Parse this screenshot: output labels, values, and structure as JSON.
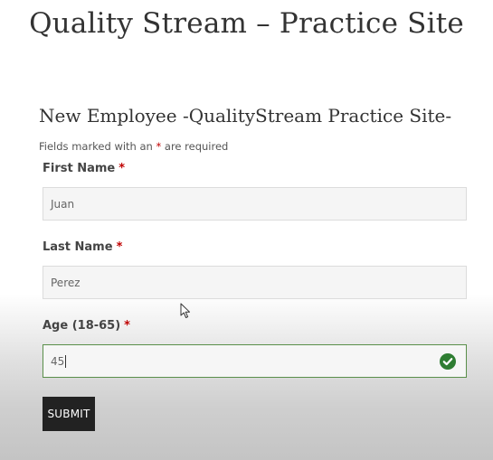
{
  "site": {
    "title": "Quality Stream – Practice Site"
  },
  "form": {
    "title": "New Employee -QualityStream Practice Site-",
    "required_note_prefix": "Fields marked with an",
    "required_note_star": "*",
    "required_note_suffix": "are required",
    "fields": [
      {
        "label": "First Name",
        "star": "*",
        "value": "Juan"
      },
      {
        "label": "Last Name",
        "star": "*",
        "value": "Perez"
      },
      {
        "label": "Age (18-65)",
        "star": "*",
        "value": "45"
      }
    ],
    "submit_label": "SUBMIT"
  },
  "colors": {
    "required_star": "#c00000",
    "valid_border": "#5a8f4a",
    "valid_check": "#2e7d32",
    "submit_bg": "#222222"
  },
  "icons": {
    "valid": "check-circle-icon",
    "pointer": "mouse-pointer-icon"
  }
}
